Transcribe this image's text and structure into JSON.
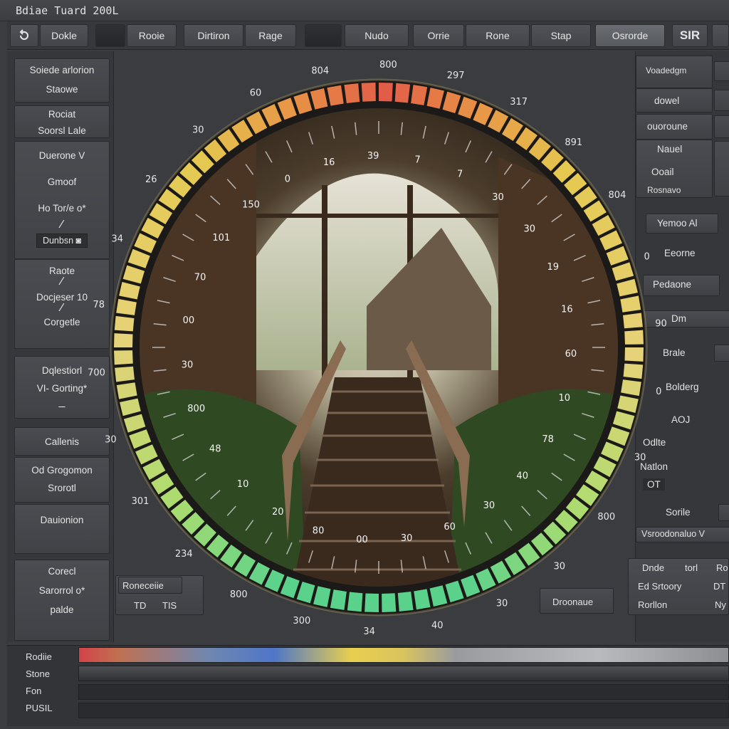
{
  "window": {
    "title": "Bdiae Tuard 200L"
  },
  "toolbar": {
    "items": [
      {
        "label": ""
      },
      {
        "label": "Dokle"
      },
      {
        "label": ""
      },
      {
        "label": "Rooie"
      },
      {
        "label": "Dirtiron"
      },
      {
        "label": "Rage"
      },
      {
        "label": ""
      },
      {
        "label": "Nudo"
      },
      {
        "label": "Orrie"
      },
      {
        "label": "Rone"
      },
      {
        "label": "Stap"
      },
      {
        "label": "Osrorde"
      },
      {
        "label": "SIR"
      }
    ]
  },
  "left_panel": {
    "groups": [
      {
        "lines": [
          "Soiede arlorion",
          "Staowe"
        ]
      },
      {
        "lines": [
          "Rociat",
          "Soorsl Lale"
        ]
      },
      {
        "lines": [
          "Duerone V",
          "Gmoof",
          "Ho Tor/e o*"
        ],
        "button": "Dunbsn"
      },
      {
        "lines": [
          "Raote",
          "Docjeser 10",
          "Corgetle"
        ]
      },
      {
        "lines": [
          "Dqlestiorl",
          "VI- Gorting*"
        ]
      },
      {
        "lines": [
          "Callenis"
        ]
      },
      {
        "lines": [
          "Od Grogomon",
          "Srorotl"
        ]
      },
      {
        "lines": [
          "Dauionion"
        ]
      },
      {
        "lines": [
          "Corecl",
          "Sarorrol o*",
          "palde"
        ]
      }
    ]
  },
  "right_panel": {
    "labels": [
      "Voadedgm",
      "dowel",
      "ouoroune",
      "Nauel",
      "Ooail",
      "Rosnavo",
      "Yemoo Al",
      "Eeorne",
      "Pedaone",
      "Dm",
      "Brale",
      "Bolderg",
      "AOJ",
      "Odlte",
      "Natlon",
      "OT",
      "Sorile",
      "Vsroodonaluo V"
    ],
    "table": {
      "headers": [
        "Dnde",
        "torl",
        "Ro"
      ],
      "rows": [
        [
          "Ed Srtoory",
          "DT"
        ],
        [
          "Rorllon",
          "Ny"
        ]
      ]
    }
  },
  "dial": {
    "outer_labels": [
      "700",
      "78",
      "34",
      "26",
      "30",
      "60",
      "804",
      "800",
      "297",
      "317",
      "891",
      "804",
      "0",
      "90",
      "0",
      "30",
      "800",
      "30",
      "30",
      "40",
      "34",
      "300",
      "800",
      "234",
      "301",
      "30"
    ],
    "inner_labels": [
      "16",
      "39",
      "7",
      "7",
      "30",
      "30",
      "19",
      "16",
      "60",
      "10",
      "78",
      "40",
      "30",
      "60",
      "30",
      "00",
      "80",
      "20",
      "10",
      "48",
      "800",
      "30",
      "00",
      "70",
      "101",
      "150",
      "0"
    ]
  },
  "readouts": {
    "table_a": {
      "header": "Roneceiie",
      "cells": [
        "TD",
        "TIS"
      ]
    },
    "button": "Droonaue"
  },
  "bottom": {
    "labels": [
      "Rodiie",
      "Stone",
      "Fon",
      "PUSIL"
    ]
  },
  "colors": {
    "accent_red": "#e0574a",
    "accent_yellow": "#e4c948",
    "accent_green": "#5cd18a",
    "bg": "#3a3c40"
  }
}
